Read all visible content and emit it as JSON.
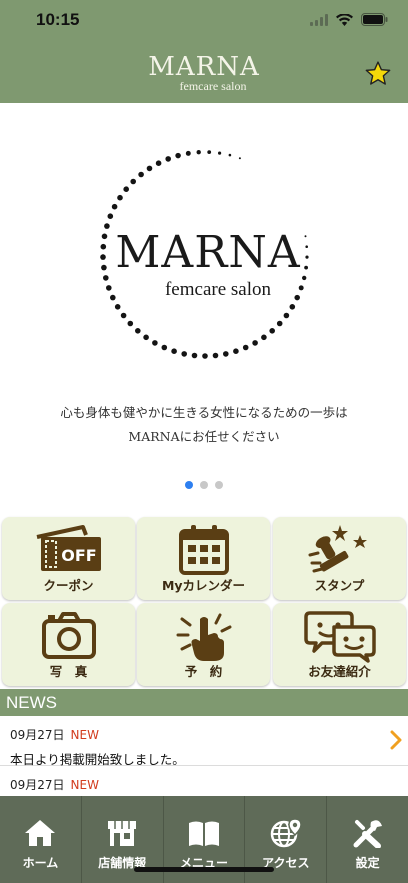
{
  "status_bar": {
    "time": "10:15"
  },
  "header": {
    "brand_name": "MARNA",
    "brand_sub": "femcare salon",
    "favorite_icon": "star-icon"
  },
  "hero": {
    "logo_name": "MARNA",
    "logo_sub": "femcare salon",
    "tagline_line1": "心も身体も健やかに生きる女性になるための一歩は",
    "tagline_line2": "MARNAにお任せください",
    "slide_count": 3,
    "active_slide": 1
  },
  "menu": {
    "coupon": {
      "label": "クーポン",
      "icon": "coupon-icon",
      "icon_text": "OFF"
    },
    "calendar": {
      "label": "Myカレンダー",
      "icon": "calendar-icon"
    },
    "stamp": {
      "label": "スタンプ",
      "icon": "stamp-icon"
    },
    "photo": {
      "label": "写　真",
      "icon": "camera-icon"
    },
    "reserve": {
      "label": "予　約",
      "icon": "hand-pointer-icon"
    },
    "friend": {
      "label": "お友達紹介",
      "icon": "chat-faces-icon"
    }
  },
  "news": {
    "title": "NEWS",
    "items": [
      {
        "date": "09月27日",
        "badge": "NEW",
        "text": "本日より掲載開始致しました。"
      },
      {
        "date": "09月27日",
        "badge": "NEW",
        "text": ""
      }
    ]
  },
  "tabbar": {
    "home": "ホーム",
    "shop": "店舗情報",
    "menu": "メニュー",
    "access": "アクセス",
    "settings": "設定"
  },
  "colors": {
    "theme": "#7f9970",
    "tile_bg": "#eef3dc",
    "icon_brown": "#5a3e14",
    "accent_blue": "#2d7ff0",
    "new_red": "#d23c1e",
    "chevron": "#f0a020"
  }
}
